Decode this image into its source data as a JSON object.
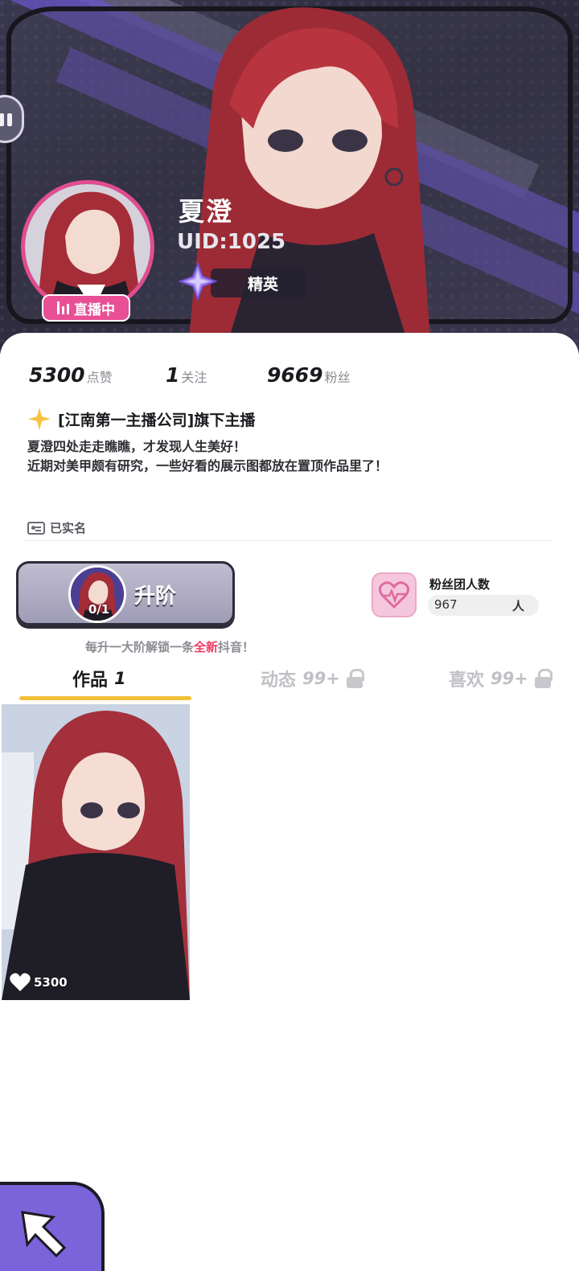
{
  "profile": {
    "name": "夏澄",
    "uid": "UID:1025",
    "live_label": "直播中",
    "rank_label": "精英"
  },
  "stats": {
    "likes": {
      "value": "5300",
      "label": "点赞"
    },
    "following": {
      "value": "1",
      "label": "关注"
    },
    "fans": {
      "value": "9669",
      "label": "粉丝"
    }
  },
  "bio": {
    "title": "[江南第一主播公司]旗下主播",
    "line1": "夏澄四处走走瞧瞧，才发现人生美好！",
    "line2": "近期对美甲颇有研究，一些好看的展示图都放在置顶作品里了！"
  },
  "verification": {
    "label": "已实名"
  },
  "upgrade": {
    "label": "升阶",
    "progress": "0/1"
  },
  "fan_club": {
    "title": "粉丝团人数",
    "count": "967",
    "unit": "人"
  },
  "tip": {
    "before": "每升一大阶解锁一条",
    "highlight": "全新",
    "after": "抖音！"
  },
  "tabs": [
    {
      "label": "作品",
      "count": "1",
      "locked": false
    },
    {
      "label": "动态",
      "count": "99+",
      "locked": true
    },
    {
      "label": "喜欢",
      "count": "99+",
      "locked": true
    }
  ],
  "works": [
    {
      "likes": "5300"
    }
  ],
  "colors": {
    "live_badge": "#e84f95",
    "tab_underline": "#f2c038",
    "tip_highlight": "#ef3a64",
    "fab": "#7b63d9"
  }
}
